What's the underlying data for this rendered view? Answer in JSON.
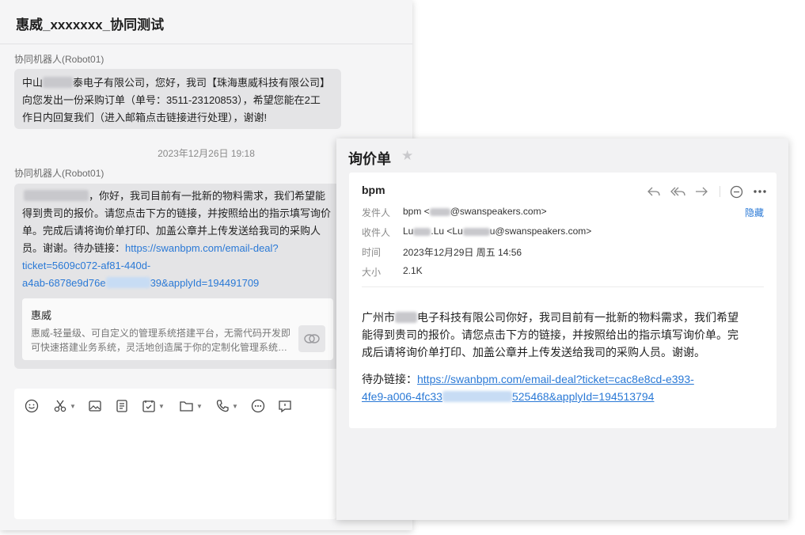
{
  "chat": {
    "title": "惠威_xxxxxxx_协同测试",
    "messages": [
      {
        "sender": "协同机器人(Robot01)",
        "lines": [
          [
            "中山",
            "泰电子有限公司，您好，我司【珠海惠威科技有限公司】"
          ],
          "向您发出一份采购订单（单号：3511-23120853），希望您能在2工",
          "作日内回复我们（进入邮箱点击链接进行处理），谢谢!"
        ]
      },
      {
        "timestamp": "2023年12月26日 19:18",
        "sender": "协同机器人(Robot01)",
        "lines": [
          "，你好，我司目前有一批新的物料需求，我们希望能",
          "得到贵司的报价。请您点击下方的链接，并按照给出的指示填写询价",
          "单。完成后请将询价单打印、加盖公章并上传发送给我司的采购人",
          "员。谢谢。待办链接："
        ],
        "link_parts": [
          "https://swanbpm.com/email-deal?",
          "ticket=5609c072-af81-440d-",
          "a4ab-6878e9d76e",
          "39&applyId=194491709"
        ],
        "card": {
          "title": "惠威",
          "desc_line1": "惠威-轻量级、可自定义的管理系统搭建平台，无需代码开发即",
          "desc_line2": "可快速搭建业务系统，灵活地创造属于你的定制化管理系统。..."
        }
      }
    ],
    "toolbar": [
      "emoji-icon",
      "scissors-icon",
      "image-icon",
      "document-icon",
      "task-icon",
      "folder-icon",
      "phone-icon",
      "more-icon",
      "message-icon"
    ]
  },
  "mail": {
    "title": "询价单",
    "from_name": "bpm",
    "meta": {
      "sender_label": "发件人",
      "sender_name": "bpm <",
      "sender_domain": "@swanspeakers.com>",
      "recipient_label": "收件人",
      "recipient_name_a": "Lu",
      "recipient_name_b": ".Lu <Lu",
      "recipient_domain": "u@swanspeakers.com>",
      "time_label": "时间",
      "time_value": "2023年12月29日 周五 14:56",
      "size_label": "大小",
      "size_value": "2.1K",
      "hide": "隐藏"
    },
    "body_prefix": "广州市",
    "body_line1": "电子科技有限公司你好，我司目前有一批新的物料需求，我们希望",
    "body_line2": "能得到贵司的报价。请您点击下方的链接，并按照给出的指示填写询价单。完",
    "body_line3": "成后请将询价单打印、加盖公章并上传发送给我司的采购人员。谢谢。",
    "pending_label": "待办链接：",
    "link_line1": "https://swanbpm.com/email-deal?ticket=cac8e8cd-e393-",
    "link_line2a": "4fe9-a006-4fc33",
    "link_line2b": "525468&applyId=194513794"
  }
}
